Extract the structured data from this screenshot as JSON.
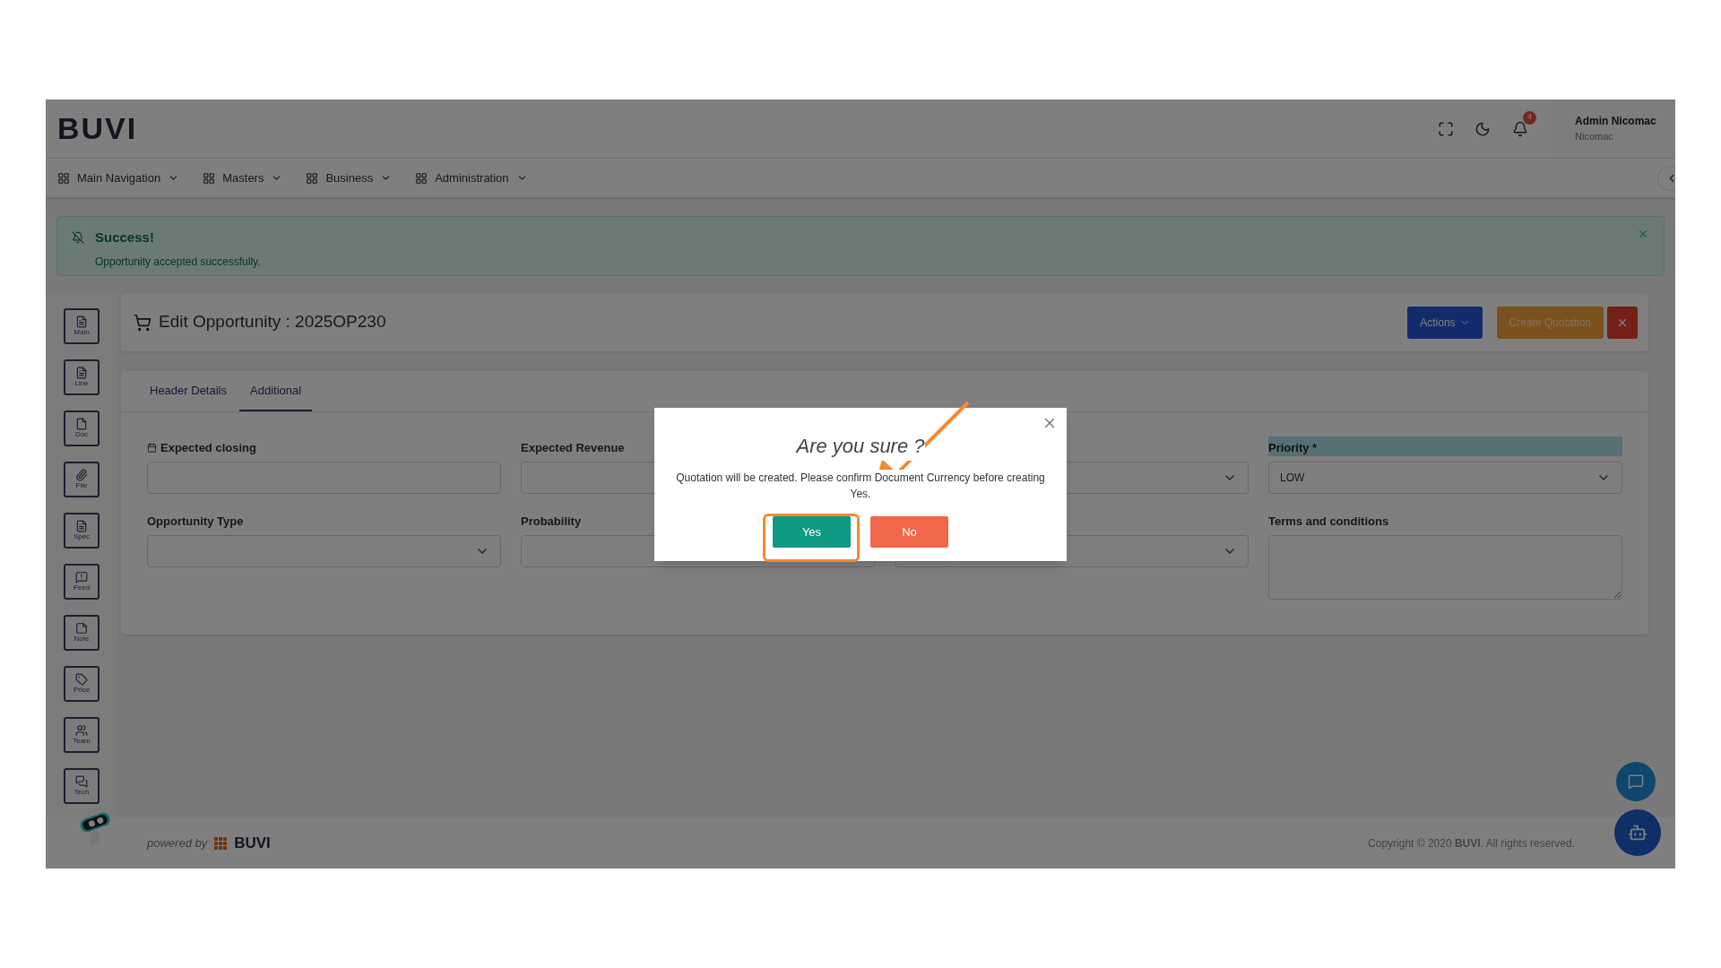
{
  "header": {
    "logo": "BUVI",
    "notification_count": "4",
    "user_name": "Admin Nicomac",
    "user_company": "Nicomac"
  },
  "nav": [
    {
      "label": "Main Navigation"
    },
    {
      "label": "Masters"
    },
    {
      "label": "Business"
    },
    {
      "label": "Administration"
    }
  ],
  "alert": {
    "title": "Success!",
    "message": "Opportunity accepted successfully."
  },
  "side_tools": [
    {
      "label": "Main"
    },
    {
      "label": "Line"
    },
    {
      "label": "Doc"
    },
    {
      "label": "File"
    },
    {
      "label": "Spec"
    },
    {
      "label": "Feed"
    },
    {
      "label": "Note"
    },
    {
      "label": "Price"
    },
    {
      "label": "Team"
    },
    {
      "label": "Tech"
    }
  ],
  "page": {
    "title": "Edit Opportunity : 2025OP230",
    "actions": "Actions",
    "create": "Create Quotation"
  },
  "tabs": [
    {
      "label": "Header Details",
      "selected": false
    },
    {
      "label": "Additional",
      "selected": true
    }
  ],
  "fields": [
    {
      "kind": "date",
      "label": "Expected closing",
      "focused": false
    },
    {
      "kind": "input",
      "label": "Expected Revenue",
      "focused": false
    },
    {
      "kind": "select",
      "focused": false
    },
    {
      "kind": "select",
      "label": "Priority *",
      "value": "LOW",
      "focused": true
    },
    {
      "kind": "select",
      "label": "Opportunity Type",
      "focused": false
    },
    {
      "kind": "input",
      "label": "Probability",
      "focused": false
    },
    {
      "kind": "select",
      "focused": false
    },
    {
      "kind": "textarea",
      "label": "Terms and conditions",
      "focused": false
    }
  ],
  "dialog": {
    "title": "Are you sure ?",
    "message": "Quotation will be created. Please confirm Document Currency before creating Yes.",
    "confirm": "Yes",
    "cancel": "No"
  },
  "footer": {
    "powered_by": "powered by",
    "brand": "BUVI",
    "copyright": "Copyright © 2020 **BUVI**. All rights reserved."
  }
}
